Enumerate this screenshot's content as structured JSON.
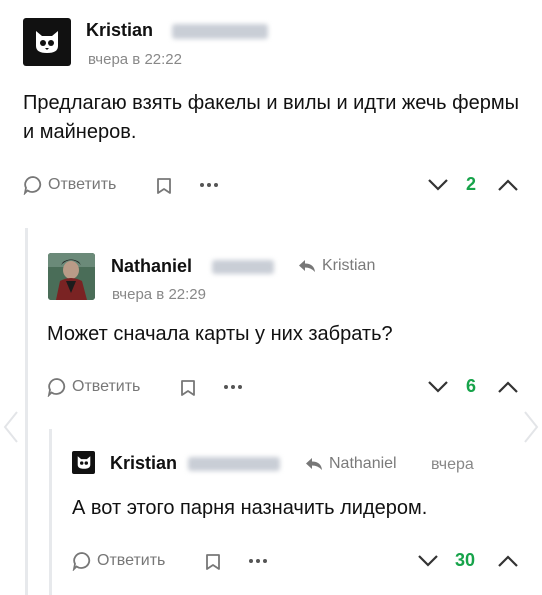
{
  "comments": [
    {
      "author": "Kristian",
      "time": "вчера в 22:22",
      "text": "Предлагаю взять факелы и вилы и идти жечь фермы и майнеров.",
      "reply_label": "Ответить",
      "score": "2",
      "avatar_icon": "owl-logo-icon"
    },
    {
      "author": "Nathaniel",
      "reply_to": "Kristian",
      "time": "вчера в 22:29",
      "text": "Может сначала карты у них забрать?",
      "reply_label": "Ответить",
      "score": "6",
      "avatar_icon": "user-photo"
    },
    {
      "author": "Kristian",
      "reply_to": "Nathaniel",
      "time": "вчера",
      "text": "А вот этого парня назначить лидером.",
      "reply_label": "Ответить",
      "score": "30",
      "avatar_icon": "owl-logo-icon"
    }
  ],
  "colors": {
    "score_positive": "#17a34a",
    "thread_line": "#e7e9ec",
    "muted_text": "#888888"
  }
}
